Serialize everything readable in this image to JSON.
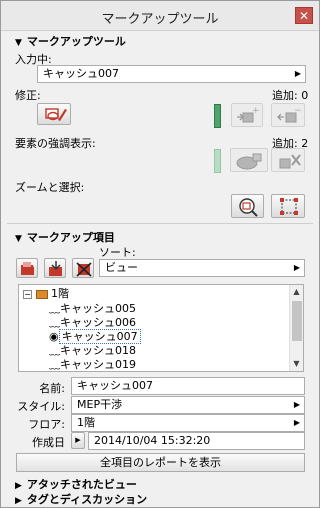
{
  "window": {
    "title": "マークアップツール",
    "close_glyph": "✕"
  },
  "markup_tool": {
    "header": "マークアップツール",
    "input_label": "入力中:",
    "input_value": "キャッシュ007",
    "modify_label": "修正:",
    "added_label": "追加: 0",
    "emphasis_label": "要素の強調表示:",
    "emphasis_added_label": "追加: 2",
    "zoom_label": "ズームと選択:"
  },
  "markup_items": {
    "header": "マークアップ項目",
    "sort_label": "ソート:",
    "sort_value": "ビュー",
    "tree": {
      "root_label": "1階",
      "items": [
        "キャッシュ005",
        "キャッシュ006",
        "キャッシュ007",
        "キャッシュ018",
        "キャッシュ019"
      ],
      "selected_index": 2
    },
    "details": {
      "name_label": "名前:",
      "name_value": "キャッシュ007",
      "style_label": "スタイル:",
      "style_value": "MEP干渉",
      "floor_label": "フロア:",
      "floor_value": "1階",
      "created_label": "作成日",
      "created_value": "2014/10/04 15:32:20"
    },
    "report_button": "全項目のレポートを表示"
  },
  "attached_views": {
    "header": "アタッチされたビュー"
  },
  "tags_discussion": {
    "header": "タグとディスカッション"
  },
  "colors": {
    "accent": "#4fa36b",
    "close": "#c7504a",
    "selection": "#3a74c5"
  }
}
